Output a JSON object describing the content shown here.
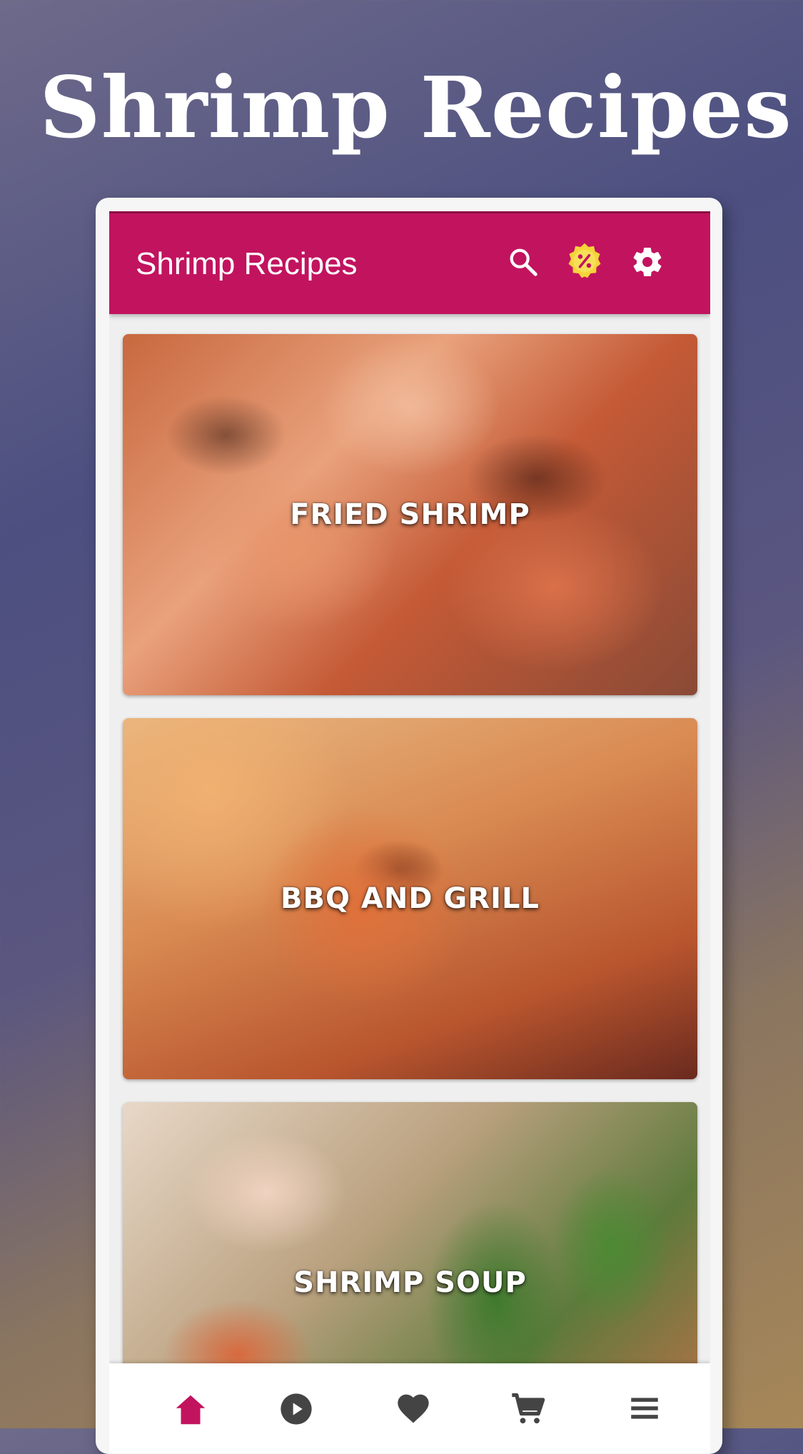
{
  "promo": {
    "title": "Shrimp Recipes"
  },
  "appbar": {
    "title": "Shrimp Recipes",
    "background": "#c2135f",
    "actions": {
      "search_icon": "search-icon",
      "promo_icon": "discount-badge-icon",
      "settings_icon": "gear-icon"
    }
  },
  "categories": [
    {
      "label": "FRIED SHRIMP"
    },
    {
      "label": "BBQ AND GRILL"
    },
    {
      "label": "SHRIMP SOUP"
    }
  ],
  "bottom_nav": {
    "active_color": "#c2135f",
    "inactive_color": "#444444",
    "items": [
      {
        "icon": "home-icon",
        "active": true
      },
      {
        "icon": "play-icon",
        "active": false
      },
      {
        "icon": "heart-icon",
        "active": false
      },
      {
        "icon": "cart-icon",
        "active": false
      },
      {
        "icon": "menu-icon",
        "active": false
      }
    ]
  }
}
